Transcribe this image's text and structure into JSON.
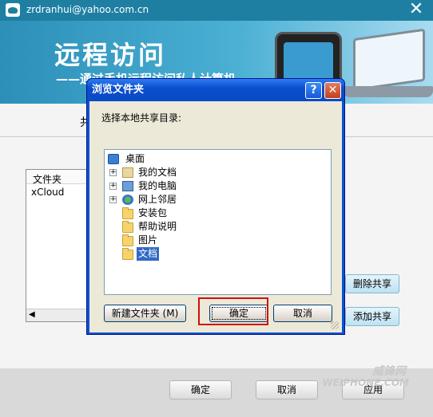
{
  "window": {
    "email": "zrdranhui@yahoo.com.cn",
    "close_glyph": "✕"
  },
  "banner": {
    "title": "远程访问",
    "subtitle": "——通过手机远程访问私人计算机"
  },
  "background": {
    "tab_fragment": "共",
    "list": {
      "header": "文件夹",
      "items": [
        "xCloud"
      ],
      "scroll_left": "◀"
    },
    "buttons": {
      "delete_share": "删除共享",
      "add_share": "添加共享"
    },
    "bottom_buttons": {
      "ok": "确定",
      "cancel": "取消",
      "apply": "应用"
    },
    "watermark": {
      "line1": "威锋网",
      "line2": "WEIPHONE.COM"
    }
  },
  "dialog": {
    "title": "浏览文件夹",
    "help_glyph": "?",
    "close_glyph": "✕",
    "label": "选择本地共享目录:",
    "tree": [
      {
        "label": "桌面",
        "icon": "desktop-icon",
        "expander": ""
      },
      {
        "label": "我的文档",
        "icon": "my-documents-icon",
        "expander": "+"
      },
      {
        "label": "我的电脑",
        "icon": "my-computer-icon",
        "expander": "+"
      },
      {
        "label": "网上邻居",
        "icon": "network-icon",
        "expander": "+"
      },
      {
        "label": "安装包",
        "icon": "folder-icon",
        "expander": ""
      },
      {
        "label": "帮助说明",
        "icon": "folder-icon",
        "expander": ""
      },
      {
        "label": "图片",
        "icon": "folder-icon",
        "expander": ""
      },
      {
        "label": "文档",
        "icon": "folder-open-icon",
        "expander": "",
        "selected": true
      }
    ],
    "buttons": {
      "new_folder": "新建文件夹 (M)",
      "ok": "确定",
      "cancel": "取消"
    }
  }
}
